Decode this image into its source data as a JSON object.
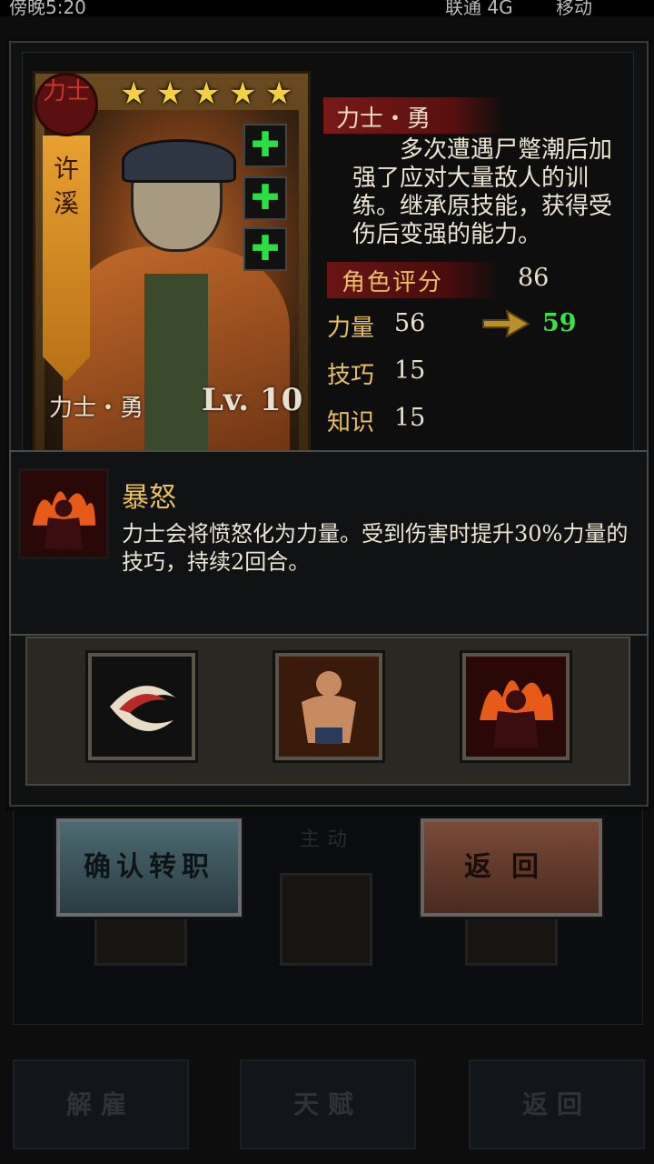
{
  "status_bar": {
    "left": "傍晚5:20",
    "carrier1": "联通 4G",
    "carrier2": "移动"
  },
  "hero": {
    "class_badge": "力士",
    "name": "许溪",
    "stars": 5,
    "class_name": "力士・勇",
    "level": "Lv. 10",
    "plus_icons": [
      "plus-icon",
      "plus-icon",
      "plus-icon"
    ]
  },
  "job": {
    "title": "力士・勇",
    "description": "多次遭遇尸蹩潮后加强了应对大量敌人的训练。继承原技能，获得受伤后变强的能力。"
  },
  "stats": {
    "rating_label": "角色评分",
    "rating_value": "86",
    "strength_label": "力量",
    "strength_value": "56",
    "strength_new": "59",
    "skill_label": "技巧",
    "skill_value": "15",
    "knowledge_label": "知识",
    "knowledge_value": "15"
  },
  "skill_detail": {
    "name": "暴怒",
    "description": "力士会将愤怒化为力量。受到伤害时提升30%力量的技巧，持续2回合。"
  },
  "skills": [
    "whirlwind-skill-icon",
    "muscle-skill-icon",
    "rage-skill-icon"
  ],
  "buttons": {
    "confirm": "确认转职",
    "back": "返回"
  },
  "background": {
    "active_label": "主动",
    "nav": [
      "解雇",
      "天赋",
      "返回"
    ]
  },
  "colors": {
    "gold": "#e8c060",
    "green": "#3ee048",
    "red_banner": "#7a1818"
  }
}
